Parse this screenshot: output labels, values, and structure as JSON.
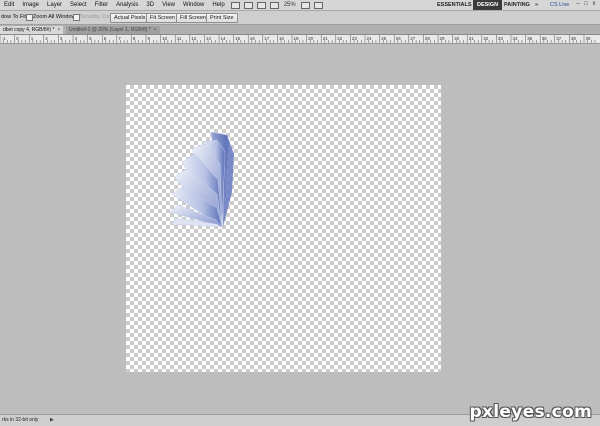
{
  "menubar": {
    "items": [
      "Edit",
      "Image",
      "Layer",
      "Select",
      "Filter",
      "Analysis",
      "3D",
      "View",
      "Window",
      "Help"
    ],
    "zoom": "25%",
    "workspaces": [
      "ESSENTIALS",
      "DESIGN",
      "PAINTING"
    ],
    "active_workspace": "DESIGN",
    "more": "»",
    "cs_live": "CS Live",
    "minimize": "–",
    "restore": "□",
    "close": "x"
  },
  "optionsbar": {
    "resize_label": "dow To Fit",
    "zoom_all_label": "Zoom All Windows",
    "scrubby_label": "Scrubby Zoom",
    "buttons": [
      "Actual Pixels",
      "Fit Screen",
      "Fill Screen",
      "Print Size"
    ]
  },
  "tabs": [
    {
      "label": "dbet copy 4, RGB/8#) *",
      "active": true
    },
    {
      "label": "Untitled-1 @ 20% (Layer 1, RGB/8) *",
      "active": false
    }
  ],
  "tab_close": "×",
  "ruler": {
    "labels": [
      "-1",
      "0",
      "1",
      "2",
      "3",
      "4",
      "5",
      "6",
      "7",
      "8",
      "9",
      "10",
      "11",
      "12",
      "13",
      "14",
      "15",
      "16",
      "17",
      "18",
      "19",
      "20",
      "21",
      "22",
      "23",
      "24",
      "25",
      "26",
      "27",
      "28",
      "29",
      "30",
      "31",
      "32",
      "33",
      "34",
      "35",
      "36",
      "37",
      "38",
      "39"
    ]
  },
  "statusbar": {
    "text": "rks in 32-bit only",
    "arrow": "▶"
  },
  "watermark": "pxleyes.com",
  "colors": {
    "workspace_bg": "#bdbdbd",
    "fan_light": "#e8ecf6",
    "fan_mid": "#9aa9d8",
    "fan_dark": "#5b6fb8",
    "active_workspace_bg": "#3b3b3b"
  }
}
